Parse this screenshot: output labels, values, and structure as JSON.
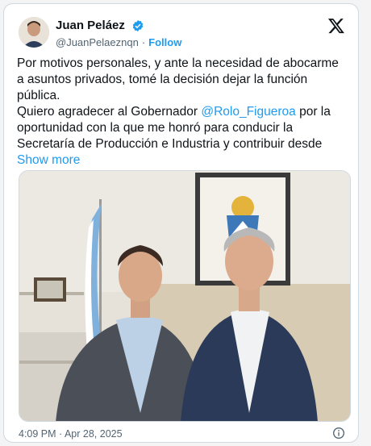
{
  "author": {
    "name": "Juan Peláez",
    "handle": "@JuanPelaeznqn",
    "follow_label": "Follow",
    "verified_color": "#1d9bf0"
  },
  "tweet": {
    "line1": "Por motivos personales, y ante la necesidad de abocarme a asuntos privados, tomé la decisión dejar la función pública.",
    "line2_before": "Quiero agradecer al Gobernador ",
    "mention": "@Rolo_Figueroa",
    "line2_after": " por la oportunidad con la que me honró para conducir la Secretaría de Producción e Industria y contribuir desde ",
    "show_more": "Show more"
  },
  "timestamp": "4:09 PM · Apr 28, 2025",
  "colors": {
    "link": "#1d9bf0",
    "muted": "#536471"
  },
  "icons": [
    "verified-badge-icon",
    "x-logo-icon",
    "info-icon"
  ]
}
